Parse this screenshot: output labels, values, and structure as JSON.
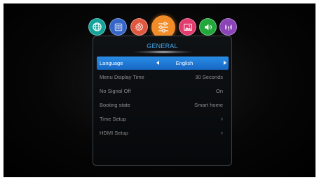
{
  "categories": [
    {
      "name": "network",
      "icon": "globe-icon",
      "color": "#13a39a",
      "active": false
    },
    {
      "name": "channel",
      "icon": "grid-dots-icon",
      "color": "#3465c8",
      "active": false
    },
    {
      "name": "settings",
      "icon": "gear-icon",
      "color": "#e0573f",
      "active": false
    },
    {
      "name": "general",
      "icon": "sliders-icon",
      "color": "#f28c28",
      "active": true
    },
    {
      "name": "picture",
      "icon": "image-icon",
      "color": "#e23b6e",
      "active": false
    },
    {
      "name": "sound",
      "icon": "speaker-icon",
      "color": "#22a83a",
      "active": false
    },
    {
      "name": "signal",
      "icon": "antenna-icon",
      "color": "#8b44b8",
      "active": false
    }
  ],
  "panel": {
    "title": "GENERAL",
    "rows": [
      {
        "label": "Language",
        "value": "English",
        "selected": true
      },
      {
        "label": "Menu Display Time",
        "value": "30 Seconds"
      },
      {
        "label": "No Signal Off",
        "value": "On"
      },
      {
        "label": "Booting state",
        "value": "Smart home"
      },
      {
        "label": "Time Setup",
        "value": "›"
      },
      {
        "label": "HDMI Setup",
        "value": "›"
      }
    ]
  },
  "colors": {
    "accent": "#1e7fe0",
    "title": "#45a9f0",
    "text": "#8c8c8c"
  }
}
